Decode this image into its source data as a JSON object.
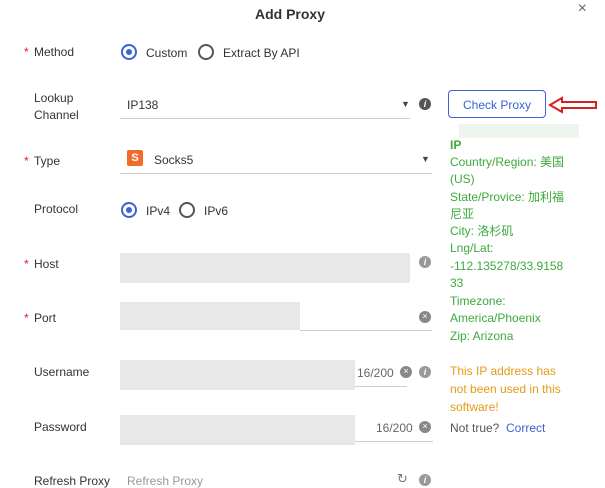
{
  "dialog": {
    "title": "Add Proxy",
    "close": "×"
  },
  "method": {
    "label": "Method",
    "options": [
      "Custom",
      "Extract By API"
    ]
  },
  "lookup": {
    "label_line1": "Lookup",
    "label_line2": "Channel",
    "value": "IP138",
    "check_button": "Check Proxy"
  },
  "type": {
    "label": "Type",
    "value": "Socks5",
    "icon_letter": "S"
  },
  "protocol": {
    "label": "Protocol",
    "options": [
      "IPv4",
      "IPv6"
    ]
  },
  "host": {
    "label": "Host"
  },
  "port": {
    "label": "Port"
  },
  "username": {
    "label": "Username",
    "counter": "16/200"
  },
  "password": {
    "label": "Password",
    "counter": "16/200"
  },
  "refresh": {
    "label": "Refresh Proxy",
    "placeholder": "Refresh Proxy"
  },
  "result": {
    "ip_label": "IP",
    "country": "Country/Region: 美国",
    "country_code": "(US)",
    "state_line1": "State/Provice: 加利福",
    "state_line2": "尼亚",
    "city": "City: 洛杉矶",
    "lnglat_label": "Lng/Lat:",
    "lnglat_line1": "-112.135278/33.9158",
    "lnglat_line2": "33",
    "timezone_label": "Timezone:",
    "timezone_value": "America/Phoenix",
    "zip": "Zip: Arizona",
    "notice_line1": "This IP address has",
    "notice_line2": "not been used in this",
    "notice_line3": "software!",
    "not_true": "Not true?",
    "correct": "Correct"
  },
  "colors": {
    "accent": "#3a63d6",
    "success": "#3caa3c",
    "warning": "#e59a14",
    "required": "#e02020"
  }
}
